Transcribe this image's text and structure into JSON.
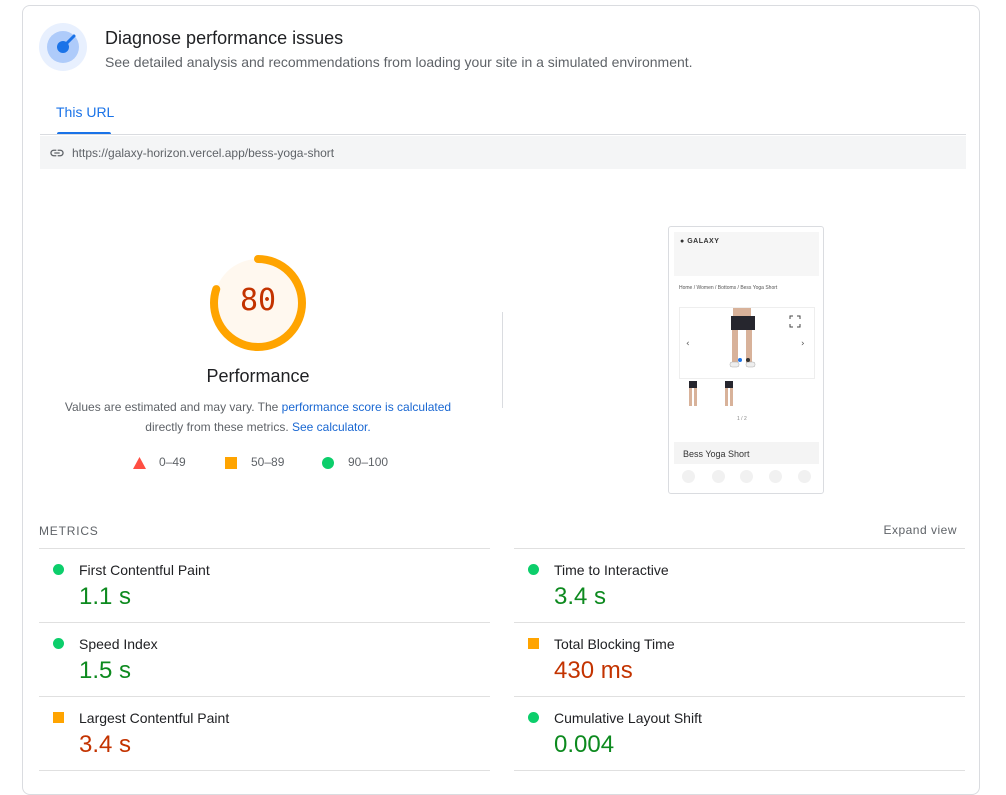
{
  "header": {
    "title": "Diagnose performance issues",
    "subtitle": "See detailed analysis and recommendations from loading your site in a simulated environment.",
    "icon": "gauge-icon"
  },
  "tabs": [
    {
      "label": "This URL",
      "active": true
    }
  ],
  "url": "https://galaxy-horizon.vercel.app/bess-yoga-short",
  "score": {
    "value": "80",
    "fraction": 0.8,
    "label": "Performance",
    "note_pre": "Values are estimated and may vary. The ",
    "note_link1": "performance score is calculated",
    "note_mid": " directly from these metrics. ",
    "note_link2": "See calculator.",
    "color": "#ffa400"
  },
  "legend": [
    {
      "range": "0–49",
      "shape": "triangle",
      "color": "#ff4e42"
    },
    {
      "range": "50–89",
      "shape": "square",
      "color": "#ffa400"
    },
    {
      "range": "90–100",
      "shape": "circle",
      "color": "#0cce6b"
    }
  ],
  "screenshot": {
    "logo": "GALAXY",
    "breadcrumb": "Home / Women / Bottoms / Bess Yoga Short",
    "image_count": "1 / 2",
    "product_name": "Bess Yoga Short"
  },
  "metrics_section": {
    "title": "METRICS",
    "expand_label": "Expand view"
  },
  "metrics": [
    {
      "name": "First Contentful Paint",
      "value": "1.1 s",
      "status": "good"
    },
    {
      "name": "Time to Interactive",
      "value": "3.4 s",
      "status": "good"
    },
    {
      "name": "Speed Index",
      "value": "1.5 s",
      "status": "good"
    },
    {
      "name": "Total Blocking Time",
      "value": "430 ms",
      "status": "average"
    },
    {
      "name": "Largest Contentful Paint",
      "value": "3.4 s",
      "status": "average"
    },
    {
      "name": "Cumulative Layout Shift",
      "value": "0.004",
      "status": "good"
    }
  ]
}
